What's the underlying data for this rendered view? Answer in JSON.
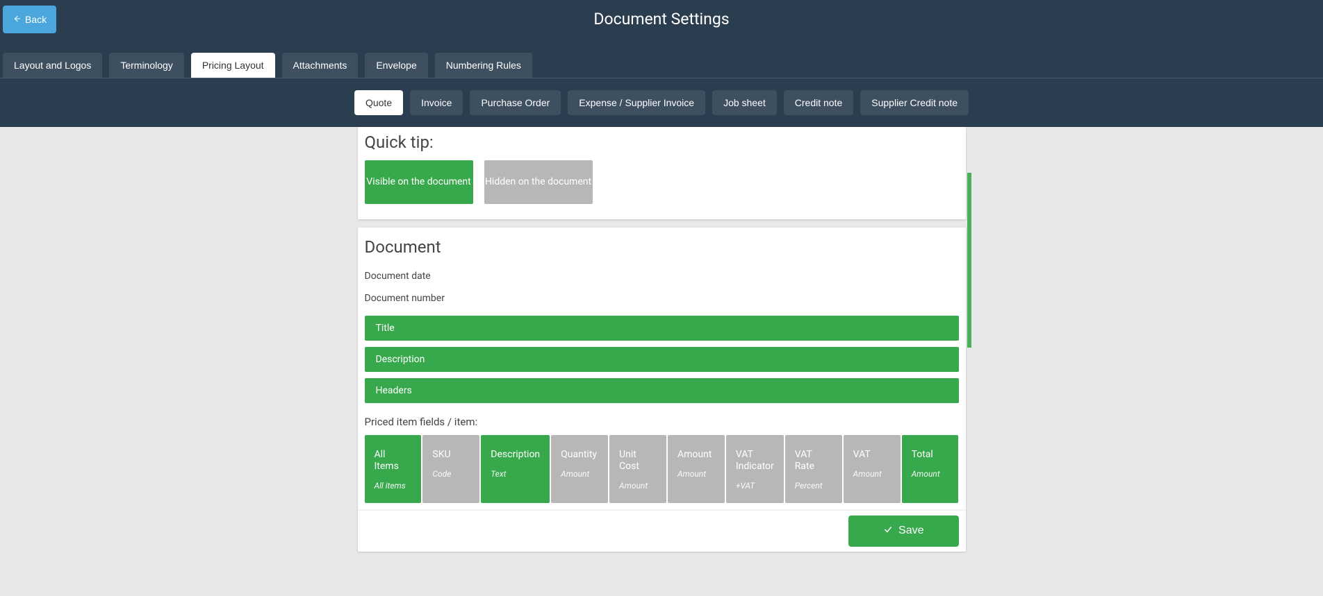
{
  "header": {
    "back_label": "Back",
    "title": "Document Settings"
  },
  "main_tabs": [
    {
      "label": "Layout and Logos",
      "active": false
    },
    {
      "label": "Terminology",
      "active": false
    },
    {
      "label": "Pricing Layout",
      "active": true
    },
    {
      "label": "Attachments",
      "active": false
    },
    {
      "label": "Envelope",
      "active": false
    },
    {
      "label": "Numbering Rules",
      "active": false
    }
  ],
  "sub_tabs": [
    {
      "label": "Quote",
      "active": true
    },
    {
      "label": "Invoice",
      "active": false
    },
    {
      "label": "Purchase Order",
      "active": false
    },
    {
      "label": "Expense / Supplier Invoice",
      "active": false
    },
    {
      "label": "Job sheet",
      "active": false
    },
    {
      "label": "Credit note",
      "active": false
    },
    {
      "label": "Supplier Credit note",
      "active": false
    }
  ],
  "quick_tip": {
    "heading": "Quick tip:",
    "visible_label": "Visible on the document",
    "hidden_label": "Hidden on the document"
  },
  "document": {
    "heading": "Document",
    "date_label": "Document date",
    "number_label": "Document number",
    "rows": [
      {
        "label": "Title",
        "visible": true
      },
      {
        "label": "Description",
        "visible": true
      },
      {
        "label": "Headers",
        "visible": true
      }
    ],
    "priced_label": "Priced item fields / item:",
    "columns": [
      {
        "title": "All Items",
        "sub": "All items",
        "visible": true
      },
      {
        "title": "SKU",
        "sub": "Code",
        "visible": false
      },
      {
        "title": "Description",
        "sub": "Text",
        "visible": true
      },
      {
        "title": "Quantity",
        "sub": "Amount",
        "visible": false
      },
      {
        "title": "Unit Cost",
        "sub": "Amount",
        "visible": false
      },
      {
        "title": "Amount",
        "sub": "Amount",
        "visible": false
      },
      {
        "title": "VAT Indicator",
        "sub": "+VAT",
        "visible": false
      },
      {
        "title": "VAT Rate",
        "sub": "Percent",
        "visible": false
      },
      {
        "title": "VAT",
        "sub": "Amount",
        "visible": false
      },
      {
        "title": "Total",
        "sub": "Amount",
        "visible": true
      }
    ]
  },
  "save_label": "Save",
  "colors": {
    "header_bg": "#2b3e50",
    "accent_blue": "#4ba7db",
    "visible_green": "#37a84b",
    "hidden_grey": "#b7b7b7"
  }
}
